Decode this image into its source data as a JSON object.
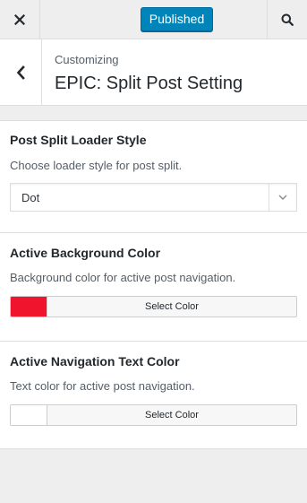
{
  "header": {
    "publish_label": "Published"
  },
  "section": {
    "crumb": "Customizing",
    "title": "EPIC: Split Post Setting"
  },
  "controls": [
    {
      "title": "Post Split Loader Style",
      "description": "Choose loader style for post split.",
      "selected": "Dot"
    },
    {
      "title": "Active Background Color",
      "description": "Background color for active post navigation.",
      "button_label": "Select Color",
      "color": "#f0142d"
    },
    {
      "title": "Active Navigation Text Color",
      "description": "Text color for active post navigation.",
      "button_label": "Select Color",
      "color": "#ffffff"
    }
  ],
  "icons": {
    "close": "close-icon",
    "search": "search-icon",
    "back": "chevron-left-icon",
    "dropdown": "chevron-down-icon"
  }
}
